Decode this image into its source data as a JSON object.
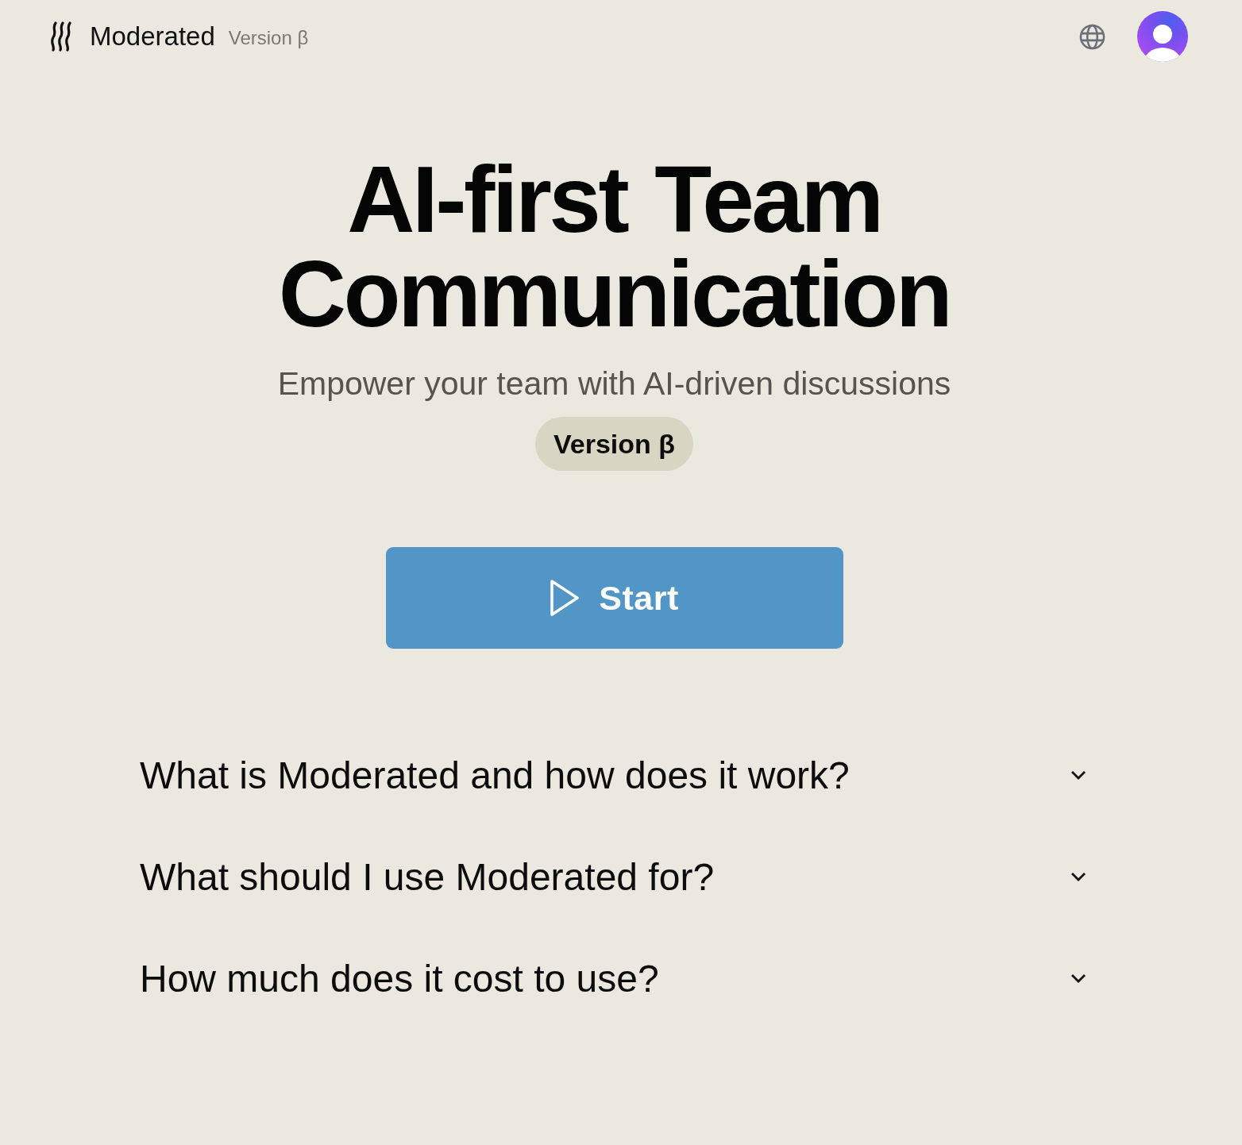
{
  "header": {
    "brand": "Moderated",
    "version": "Version β"
  },
  "hero": {
    "title": "AI-first Team Communication",
    "subtitle": "Empower your team with AI-driven discussions",
    "badge": "Version β"
  },
  "start_button": {
    "label": "Start"
  },
  "faq": [
    {
      "question": "What is Moderated and how does it work?",
      "expanded": false
    },
    {
      "question": "What should I use Moderated for?",
      "expanded": false
    },
    {
      "question": "How much does it cost to use?",
      "expanded": false
    }
  ]
}
